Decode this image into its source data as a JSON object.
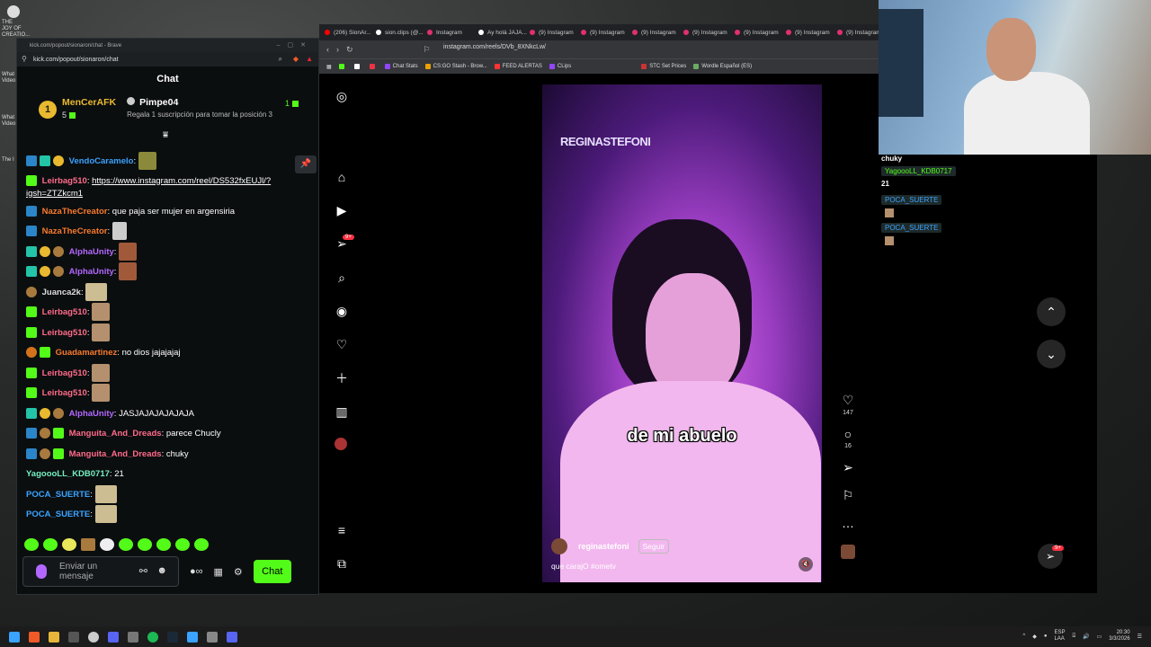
{
  "desktop": {
    "icon1_label": "THE JOY OF CREATIO...",
    "icon2_label": "What Video",
    "icon3_label": "What Video",
    "icon4_label": "The I"
  },
  "chat_window": {
    "title": "kick.com/popout/sionaron/chat - Brave",
    "url": "kick.com/popout/sionaron/chat",
    "header": "Chat",
    "leaderboard": {
      "rank": "1",
      "top_user": "MenCerAFK",
      "top_count": "5",
      "second_user": "Pimpe04",
      "second_text": "Regala 1 suscripción para tomar la posición 3",
      "second_count": "1"
    },
    "messages": [
      {
        "user": "VendoCaramelo",
        "text": ""
      },
      {
        "user": "Leirbag510",
        "text": "https://www.instagram.com/reel/DS532fxEUJl/?igsh=ZTZkcm1"
      },
      {
        "user": "NazaTheCreator",
        "text": "que paja ser mujer en argensiria"
      },
      {
        "user": "NazaTheCreator",
        "text": ""
      },
      {
        "user": "AlphaUnity",
        "text": ""
      },
      {
        "user": "AlphaUnity",
        "text": ""
      },
      {
        "user": "Juanca2k",
        "text": ""
      },
      {
        "user": "Leirbag510",
        "text": ""
      },
      {
        "user": "Leirbag510",
        "text": ""
      },
      {
        "user": "Guadamartinez",
        "text": "no dios jajajajaj"
      },
      {
        "user": "Leirbag510",
        "text": ""
      },
      {
        "user": "Leirbag510",
        "text": ""
      },
      {
        "user": "AlphaUnity",
        "text": "JASJAJAJAJAJAJA"
      },
      {
        "user": "Manguita_And_Dreads",
        "text": "parece Chucly"
      },
      {
        "user": "Manguita_And_Dreads",
        "text": "chuky"
      },
      {
        "user": "YagoooLL_KDB0717",
        "text": "21"
      },
      {
        "user": "POCA_SUERTE",
        "text": ""
      },
      {
        "user": "POCA_SUERTE",
        "text": ""
      }
    ],
    "input_placeholder": "Enviar un mensaje",
    "chat_button": "Chat"
  },
  "browser": {
    "tabs": [
      "(206) SionAr...",
      "sion.clips (@...",
      "Instagram",
      "Ay holá JAJA...",
      "(9) Instagram",
      "(9) Instagram",
      "(9) Instagram",
      "(9) Instagram",
      "(9) Instagram",
      "(9) Instagram",
      "(9) Instagram"
    ],
    "url": "instagram.com/reels/DVb_8XNkcLw/",
    "bookmarks": [
      "Chat Stats",
      "CS:GO Stash - Brow...",
      "FEED ALERTAS",
      "CLips",
      "STC Set Prices",
      "Wordle Español (ES)"
    ]
  },
  "instagram": {
    "notif_badge": "9+",
    "reel": {
      "watermark": "REGINASTEFONI",
      "caption": "de mi abuelo",
      "username": "reginastefoni",
      "follow": "Seguir",
      "description": "que carajO #ometv"
    },
    "likes": "147",
    "comments": "16",
    "dm_badge": "9+"
  },
  "overlay": {
    "line1": "chuky",
    "user2": "YagoooLL_KDB0717",
    "line2": "21",
    "user3": "POCA_SUERTE",
    "user4": "POCA_SUERTE"
  },
  "taskbar": {
    "lang": "ESP\nLAA",
    "time": "20:30",
    "date": "3/3/2026"
  }
}
